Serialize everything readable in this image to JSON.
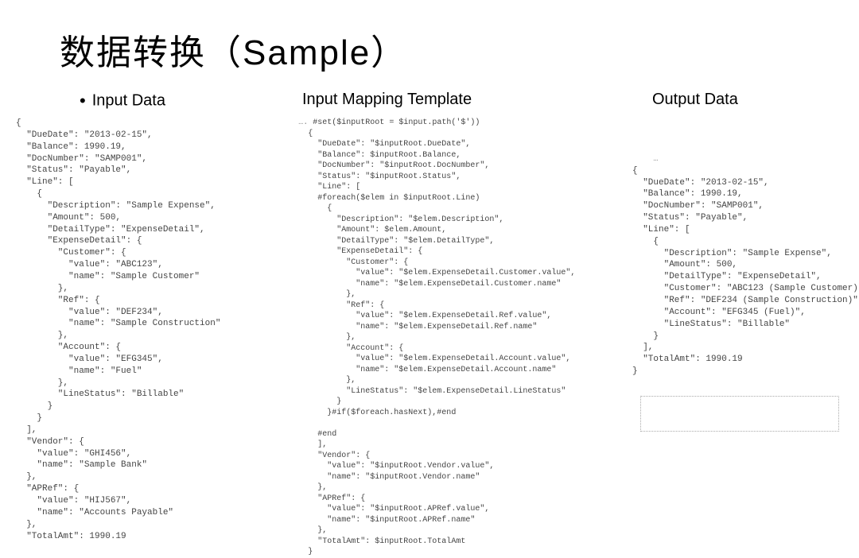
{
  "title": "数据转换（Sample）",
  "headers": {
    "input_data": "Input Data",
    "mapping": "Input Mapping Template",
    "output": "Output Data"
  },
  "input_data_code": "{\n  \"DueDate\": \"2013-02-15\",\n  \"Balance\": 1990.19,\n  \"DocNumber\": \"SAMP001\",\n  \"Status\": \"Payable\",\n  \"Line\": [\n    {\n      \"Description\": \"Sample Expense\",\n      \"Amount\": 500,\n      \"DetailType\": \"ExpenseDetail\",\n      \"ExpenseDetail\": {\n        \"Customer\": {\n          \"value\": \"ABC123\",\n          \"name\": \"Sample Customer\"\n        },\n        \"Ref\": {\n          \"value\": \"DEF234\",\n          \"name\": \"Sample Construction\"\n        },\n        \"Account\": {\n          \"value\": \"EFG345\",\n          \"name\": \"Fuel\"\n        },\n        \"LineStatus\": \"Billable\"\n      }\n    }\n  ],\n  \"Vendor\": {\n    \"value\": \"GHI456\",\n    \"name\": \"Sample Bank\"\n  },\n  \"APRef\": {\n    \"value\": \"HIJ567\",\n    \"name\": \"Accounts Payable\"\n  },\n  \"TotalAmt\": 1990.19",
  "mapping_prefix": "….",
  "mapping_code": " #set($inputRoot = $input.path('$'))\n  {\n    \"DueDate\": \"$inputRoot.DueDate\",\n    \"Balance\": $inputRoot.Balance,\n    \"DocNumber\": \"$inputRoot.DocNumber\",\n    \"Status\": \"$inputRoot.Status\",\n    \"Line\": [\n    #foreach($elem in $inputRoot.Line)\n      {\n        \"Description\": \"$elem.Description\",\n        \"Amount\": $elem.Amount,\n        \"DetailType\": \"$elem.DetailType\",\n        \"ExpenseDetail\": {\n          \"Customer\": {\n            \"value\": \"$elem.ExpenseDetail.Customer.value\",\n            \"name\": \"$elem.ExpenseDetail.Customer.name\"\n          },\n          \"Ref\": {\n            \"value\": \"$elem.ExpenseDetail.Ref.value\",\n            \"name\": \"$elem.ExpenseDetail.Ref.name\"\n          },\n          \"Account\": {\n            \"value\": \"$elem.ExpenseDetail.Account.value\",\n            \"name\": \"$elem.ExpenseDetail.Account.name\"\n          },\n          \"LineStatus\": \"$elem.ExpenseDetail.LineStatus\"\n        }\n      }#if($foreach.hasNext),#end\n\n    #end\n    ],\n    \"Vendor\": {\n      \"value\": \"$inputRoot.Vendor.value\",\n      \"name\": \"$inputRoot.Vendor.name\"\n    },\n    \"APRef\": {\n      \"value\": \"$inputRoot.APRef.value\",\n      \"name\": \"$inputRoot.APRef.name\"\n    },\n    \"TotalAmt\": $inputRoot.TotalAmt\n  }",
  "output_prefix": "…",
  "output_code": "{\n  \"DueDate\": \"2013-02-15\",\n  \"Balance\": 1990.19,\n  \"DocNumber\": \"SAMP001\",\n  \"Status\": \"Payable\",\n  \"Line\": [\n    {\n      \"Description\": \"Sample Expense\",\n      \"Amount\": 500,\n      \"DetailType\": \"ExpenseDetail\",\n      \"Customer\": \"ABC123 (Sample Customer)\",\n      \"Ref\": \"DEF234 (Sample Construction)\",\n      \"Account\": \"EFG345 (Fuel)\",\n      \"LineStatus\": \"Billable\"\n    }\n  ],\n  \"TotalAmt\": 1990.19\n}"
}
